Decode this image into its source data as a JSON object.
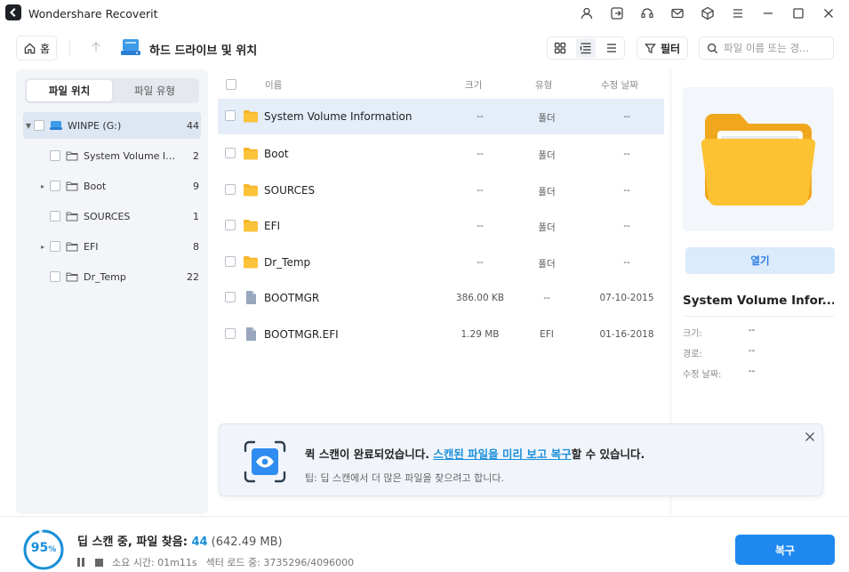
{
  "app": {
    "title": "Wondershare Recoverit"
  },
  "toolbar": {
    "home_label": "홈",
    "breadcrumb": "하드 드라이브 및 위치",
    "filter_label": "필터",
    "search_placeholder": "파일 이름 또는 경..."
  },
  "sidebar": {
    "tabs": [
      "파일 위치",
      "파일 유형"
    ],
    "tree": [
      {
        "label": "WINPE (G:)",
        "count": "44"
      },
      {
        "label": "System Volume Infor...",
        "count": "2"
      },
      {
        "label": "Boot",
        "count": "9"
      },
      {
        "label": "SOURCES",
        "count": "1"
      },
      {
        "label": "EFI",
        "count": "8"
      },
      {
        "label": "Dr_Temp",
        "count": "22"
      }
    ]
  },
  "list": {
    "columns": {
      "name": "이름",
      "size": "크기",
      "type": "유형",
      "modified": "수정 날짜"
    },
    "rows": [
      {
        "name": "System Volume Information",
        "size": "--",
        "type": "폴더",
        "date": "--"
      },
      {
        "name": "Boot",
        "size": "--",
        "type": "폴더",
        "date": "--"
      },
      {
        "name": "SOURCES",
        "size": "--",
        "type": "폴더",
        "date": "--"
      },
      {
        "name": "EFI",
        "size": "--",
        "type": "폴더",
        "date": "--"
      },
      {
        "name": "Dr_Temp",
        "size": "--",
        "type": "폴더",
        "date": "--"
      },
      {
        "name": "BOOTMGR",
        "size": "386.00 KB",
        "type": "--",
        "date": "07-10-2015"
      },
      {
        "name": "BOOTMGR.EFI",
        "size": "1.29 MB",
        "type": "EFI",
        "date": "01-16-2018"
      }
    ]
  },
  "preview": {
    "open_label": "열기",
    "name": "System Volume Infor...",
    "meta": [
      {
        "key": "크기:",
        "value": "--"
      },
      {
        "key": "경로:",
        "value": "--"
      },
      {
        "key": "수정 날짜:",
        "value": "--"
      }
    ]
  },
  "notification": {
    "main_prefix": "퀵 스캔이 완료되었습니다. ",
    "main_link": "스캔된 파일을 미리 보고 복구",
    "main_suffix": "할 수 있습니다.",
    "tip": "팁: 딥 스캔에서 더 많은 파일을 찾으려고 합니다."
  },
  "footer": {
    "progress_value": "95",
    "progress_unit": "%",
    "progress_fraction": 0.95,
    "scan_label": "딥 스캔 중, 파일 찾음: ",
    "found_count": "44",
    "found_size": " (642.49 MB)",
    "elapsed": "소요 시간: 01m11s",
    "sectors": "섹터 로드 중: 3735296/4096000",
    "recover_label": "복구"
  },
  "colors": {
    "accent": "#1e88f0",
    "link": "#1a8fd8",
    "folder": "#f7b529"
  }
}
